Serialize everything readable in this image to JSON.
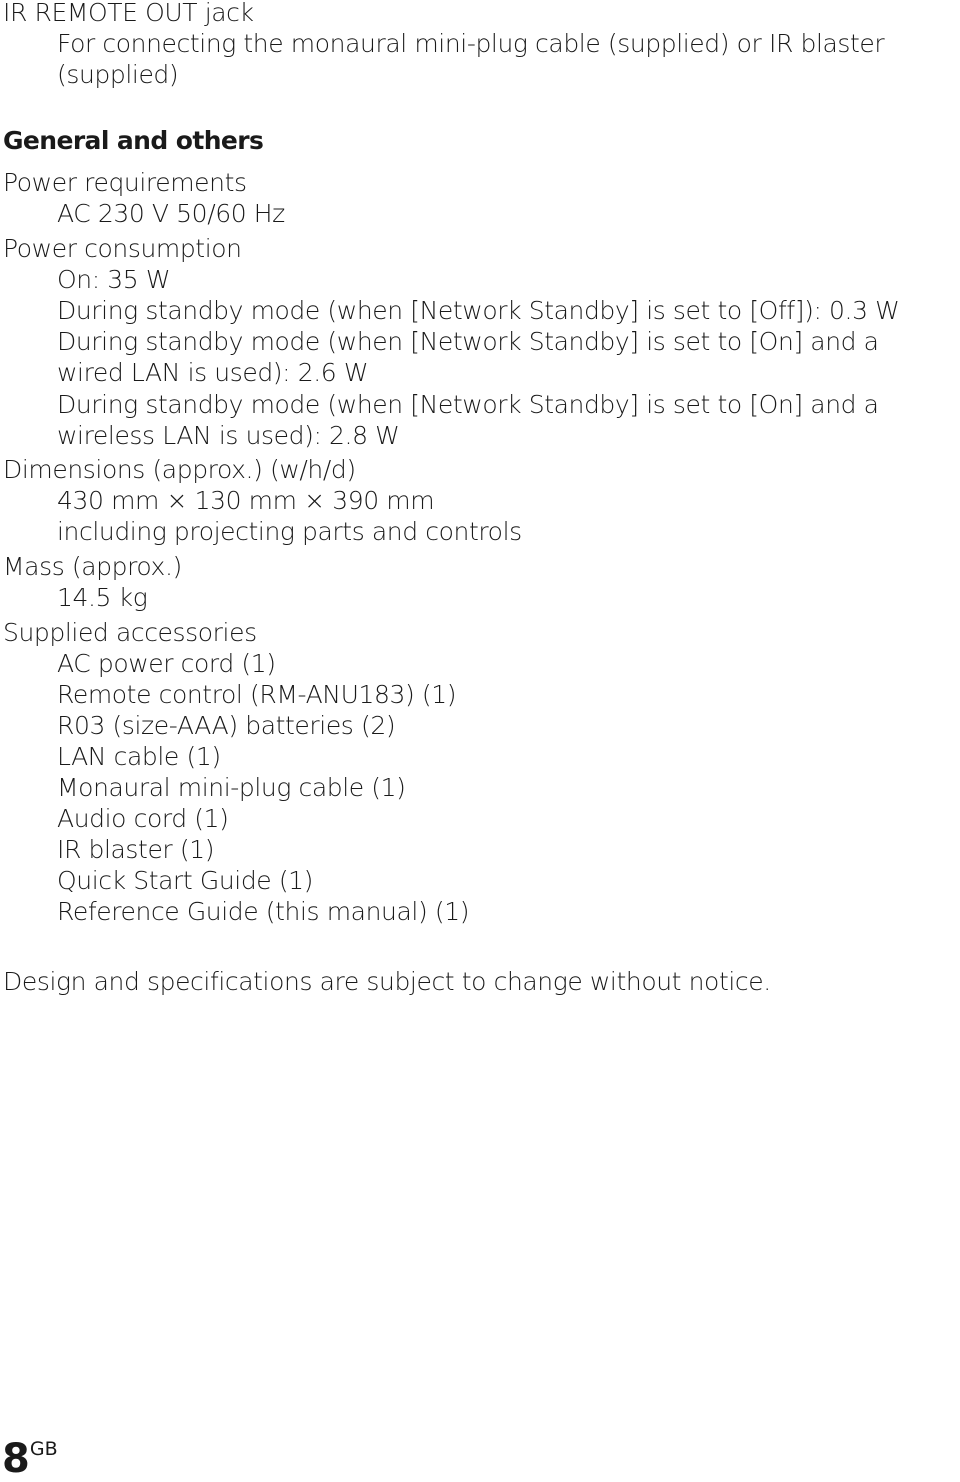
{
  "ir_remote": {
    "label": "IR REMOTE OUT jack",
    "desc_line1": "For connecting the monaural mini-plug cable (supplied) or IR blaster",
    "desc_line2": "(supplied)"
  },
  "general": {
    "heading": "General and others",
    "power_requirements": {
      "label": "Power requirements",
      "value": "AC 230 V 50/60 Hz"
    },
    "power_consumption": {
      "label": "Power consumption",
      "on": "On: 35 W",
      "standby_off": "During standby mode (when [Network Standby] is set to [Off]): 0.3 W",
      "standby_wired_line1": "During standby mode (when [Network Standby] is set to [On] and a",
      "standby_wired_line2": "wired LAN is used): 2.6 W",
      "standby_wireless_line1": "During standby mode (when [Network Standby] is set to [On] and a",
      "standby_wireless_line2": "wireless LAN is used): 2.8 W"
    },
    "dimensions": {
      "label": "Dimensions (approx.) (w/h/d)",
      "value": "430 mm × 130 mm × 390 mm",
      "note": "including projecting parts and controls"
    },
    "mass": {
      "label": "Mass (approx.)",
      "value": "14.5 kg"
    },
    "accessories": {
      "label": "Supplied accessories",
      "items": [
        "AC power cord (1)",
        "Remote control (RM-ANU183) (1)",
        "R03 (size-AAA) batteries (2)",
        "LAN cable (1)",
        "Monaural mini-plug cable (1)",
        "Audio cord (1)",
        "IR blaster (1)",
        "Quick Start Guide (1)",
        "Reference Guide (this manual) (1)"
      ]
    }
  },
  "notice": "Design and specifications are subject to change without notice.",
  "page_number": {
    "number": "8",
    "suffix": "GB"
  }
}
